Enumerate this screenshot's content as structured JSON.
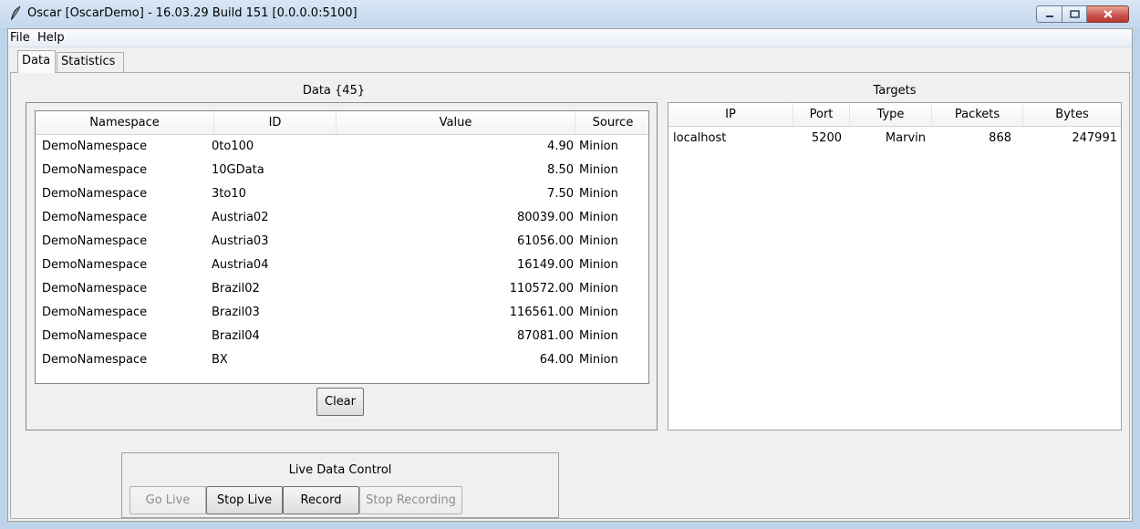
{
  "window": {
    "title": "Oscar [OscarDemo] - 16.03.29 Build 151 [0.0.0.0:5100]"
  },
  "menu": {
    "file": "File",
    "help": "Help"
  },
  "tabs": {
    "data": "Data",
    "statistics": "Statistics"
  },
  "data_panel": {
    "caption": "Data {45}",
    "columns": {
      "namespace": "Namespace",
      "id": "ID",
      "value": "Value",
      "source": "Source"
    },
    "rows": [
      {
        "namespace": "DemoNamespace",
        "id": "0to100",
        "value": "4.90",
        "source": "Minion"
      },
      {
        "namespace": "DemoNamespace",
        "id": "10GData",
        "value": "8.50",
        "source": "Minion"
      },
      {
        "namespace": "DemoNamespace",
        "id": "3to10",
        "value": "7.50",
        "source": "Minion"
      },
      {
        "namespace": "DemoNamespace",
        "id": "Austria02",
        "value": "80039.00",
        "source": "Minion"
      },
      {
        "namespace": "DemoNamespace",
        "id": "Austria03",
        "value": "61056.00",
        "source": "Minion"
      },
      {
        "namespace": "DemoNamespace",
        "id": "Austria04",
        "value": "16149.00",
        "source": "Minion"
      },
      {
        "namespace": "DemoNamespace",
        "id": "Brazil02",
        "value": "110572.00",
        "source": "Minion"
      },
      {
        "namespace": "DemoNamespace",
        "id": "Brazil03",
        "value": "116561.00",
        "source": "Minion"
      },
      {
        "namespace": "DemoNamespace",
        "id": "Brazil04",
        "value": "87081.00",
        "source": "Minion"
      },
      {
        "namespace": "DemoNamespace",
        "id": "BX",
        "value": "64.00",
        "source": "Minion"
      }
    ],
    "clear_label": "Clear"
  },
  "targets_panel": {
    "caption": "Targets",
    "columns": {
      "ip": "IP",
      "port": "Port",
      "type": "Type",
      "packets": "Packets",
      "bytes": "Bytes"
    },
    "rows": [
      {
        "ip": "localhost",
        "port": "5200",
        "type": "Marvin",
        "packets": "868",
        "bytes": "247991"
      }
    ]
  },
  "live_control": {
    "caption": "Live Data Control",
    "go_live": "Go Live",
    "stop_live": "Stop Live",
    "record": "Record",
    "stop_recording": "Stop Recording"
  },
  "icons": {
    "app": "feather-icon",
    "minimize": "minimize-icon",
    "maximize": "maximize-icon",
    "close": "close-icon"
  }
}
